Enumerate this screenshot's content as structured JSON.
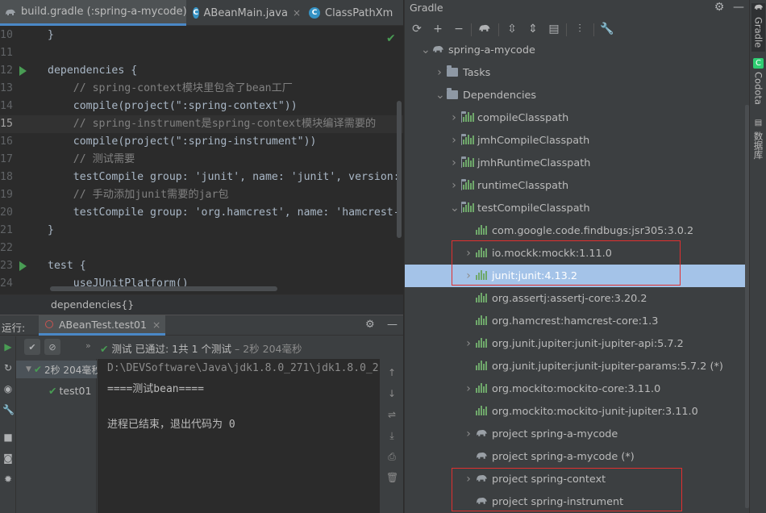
{
  "editor": {
    "tabs": [
      {
        "label": "build.gradle (:spring-a-mycode)",
        "icon": "gradle-elephant-icon",
        "close": "×"
      },
      {
        "label": "ABeanMain.java",
        "icon": "java-class-icon",
        "close": "×"
      },
      {
        "label": "ClassPathXm",
        "icon": "java-class-icon",
        "close": ""
      }
    ],
    "lines": [
      {
        "num": "10",
        "text": "}"
      },
      {
        "num": "11",
        "text": ""
      },
      {
        "num": "12",
        "text": "dependencies {"
      },
      {
        "num": "13",
        "text": "    // spring-context模块里包含了bean工厂"
      },
      {
        "num": "14",
        "text": "    compile(project(\":spring-context\"))"
      },
      {
        "num": "15",
        "text": "    // spring-instrument是spring-context模块编译需要的"
      },
      {
        "num": "16",
        "text": "    compile(project(\":spring-instrument\"))"
      },
      {
        "num": "17",
        "text": "    // 测试需要"
      },
      {
        "num": "18",
        "text": "    testCompile group: 'junit', name: 'junit', version:"
      },
      {
        "num": "19",
        "text": "    // 手动添加junit需要的jar包"
      },
      {
        "num": "20",
        "text": "    testCompile group: 'org.hamcrest', name: 'hamcrest-"
      },
      {
        "num": "21",
        "text": "}"
      },
      {
        "num": "22",
        "text": ""
      },
      {
        "num": "23",
        "text": "test {"
      },
      {
        "num": "24",
        "text": "    useJUnitPlatform()"
      }
    ],
    "breadcrumb": "dependencies{}"
  },
  "run": {
    "label": "运行:",
    "tab_label": "ABeanTest.test01",
    "tab_close": "×",
    "status_prefix": "测试 已通过:",
    "status_count": "1共 1 个测试",
    "status_time": "– 2秒 204毫秒",
    "tree_root_time": "2秒 204毫秒",
    "tree_child": "test01",
    "console_lines": [
      "D:\\DEVSoftware\\Java\\jdk1.8.0_271\\jdk1.8.0_2",
      "====测试bean====",
      "",
      "进程已结束，退出代码为 0"
    ]
  },
  "gradle": {
    "title": "Gradle",
    "toolbar_icons": [
      "refresh-icon",
      "add-icon",
      "remove-icon",
      "elephant-icon",
      "expand-all-icon",
      "collapse-all-icon",
      "group-modules-icon",
      "toggle-offline-icon",
      "settings-wrench-icon"
    ],
    "tree": [
      {
        "label": "spring-a-mycode",
        "level": 0,
        "arrow": "down",
        "icon": "elephant"
      },
      {
        "label": "Tasks",
        "level": 1,
        "arrow": "right",
        "icon": "folder"
      },
      {
        "label": "Dependencies",
        "level": 1,
        "arrow": "down",
        "icon": "folder"
      },
      {
        "label": "compileClasspath",
        "level": 2,
        "arrow": "right",
        "icon": "folderbars"
      },
      {
        "label": "jmhCompileClasspath",
        "level": 2,
        "arrow": "right",
        "icon": "folderbars"
      },
      {
        "label": "jmhRuntimeClasspath",
        "level": 2,
        "arrow": "right",
        "icon": "folderbars"
      },
      {
        "label": "runtimeClasspath",
        "level": 2,
        "arrow": "right",
        "icon": "folderbars"
      },
      {
        "label": "testCompileClasspath",
        "level": 2,
        "arrow": "down",
        "icon": "folderbars"
      },
      {
        "label": "com.google.code.findbugs:jsr305:3.0.2",
        "level": 3,
        "arrow": "",
        "icon": "bars"
      },
      {
        "label": "io.mockk:mockk:1.11.0",
        "level": 3,
        "arrow": "right",
        "icon": "bars"
      },
      {
        "label": "junit:junit:4.13.2",
        "level": 3,
        "arrow": "right",
        "icon": "bars",
        "selected": true
      },
      {
        "label": "org.assertj:assertj-core:3.20.2",
        "level": 3,
        "arrow": "",
        "icon": "bars"
      },
      {
        "label": "org.hamcrest:hamcrest-core:1.3",
        "level": 3,
        "arrow": "",
        "icon": "bars"
      },
      {
        "label": "org.junit.jupiter:junit-jupiter-api:5.7.2",
        "level": 3,
        "arrow": "right",
        "icon": "bars"
      },
      {
        "label": "org.junit.jupiter:junit-jupiter-params:5.7.2 (*)",
        "level": 3,
        "arrow": "",
        "icon": "bars"
      },
      {
        "label": "org.mockito:mockito-core:3.11.0",
        "level": 3,
        "arrow": "right",
        "icon": "bars"
      },
      {
        "label": "org.mockito:mockito-junit-jupiter:3.11.0",
        "level": 3,
        "arrow": "",
        "icon": "bars"
      },
      {
        "label": "project spring-a-mycode",
        "level": 3,
        "arrow": "right",
        "icon": "elephant"
      },
      {
        "label": "project spring-a-mycode (*)",
        "level": 3,
        "arrow": "",
        "icon": "elephant"
      },
      {
        "label": "project spring-context",
        "level": 3,
        "arrow": "right",
        "icon": "elephant"
      },
      {
        "label": "project spring-instrument",
        "level": 3,
        "arrow": "",
        "icon": "elephant"
      }
    ]
  },
  "right_stripe": {
    "tabs": [
      "Gradle",
      "Codota",
      "数据库"
    ]
  },
  "colors": {
    "editor_bg": "#2b2b2b",
    "panel_bg": "#3c3f41",
    "selection": "#a4c3e8",
    "highlight_box": "#e03030",
    "pass_green": "#499c54"
  }
}
